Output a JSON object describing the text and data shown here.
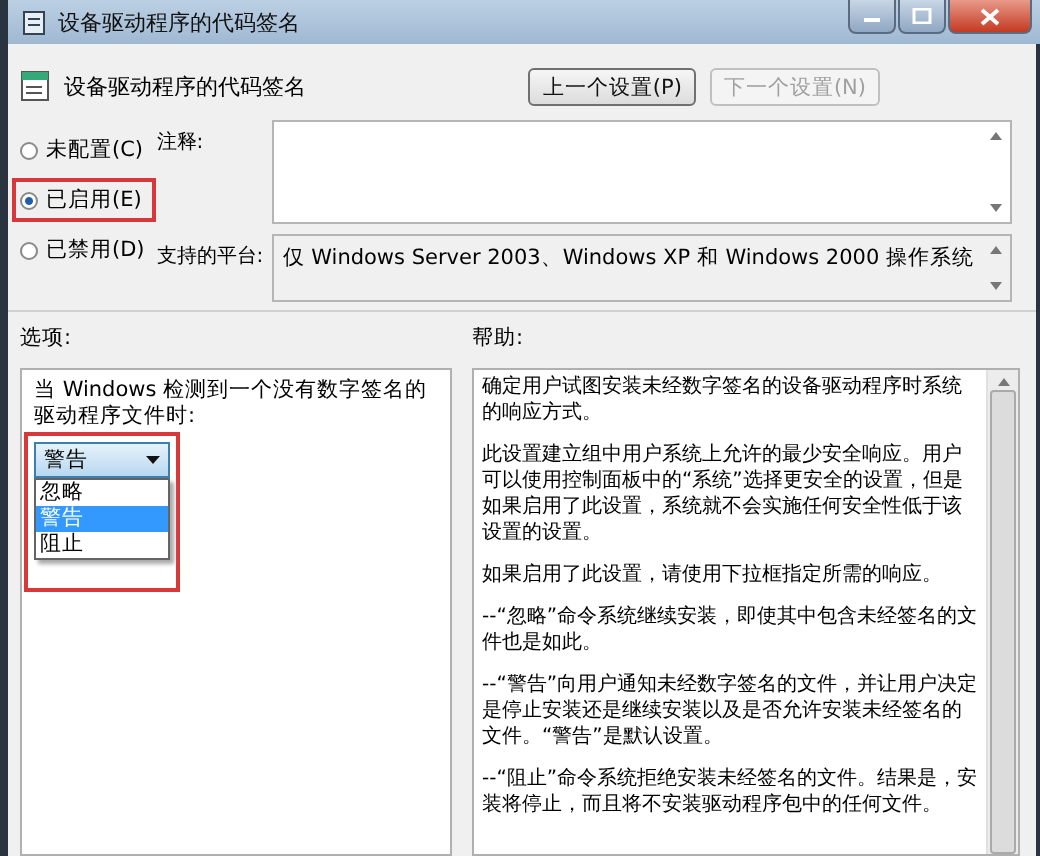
{
  "window": {
    "title": "设备驱动程序的代码签名"
  },
  "header": {
    "title": "设备驱动程序的代码签名"
  },
  "nav_buttons": [
    {
      "label": "上一个设置(P)",
      "disabled": false
    },
    {
      "label": "下一个设置(N)",
      "disabled": true
    }
  ],
  "state_options": [
    {
      "label": "未配置(C)",
      "selected": false,
      "highlighted": false
    },
    {
      "label": "已启用(E)",
      "selected": true,
      "highlighted": true
    },
    {
      "label": "已禁用(D)",
      "selected": false,
      "highlighted": false
    }
  ],
  "comment": {
    "label": "注释:"
  },
  "platform": {
    "label": "支持的平台:",
    "value": "仅 Windows Server 2003、Windows XP 和 Windows 2000 操作系统"
  },
  "options": {
    "label": "选项:",
    "prompt": "当 Windows 检测到一个没有数字签名的驱动程序文件时:",
    "dropdown": {
      "value": "警告",
      "expanded": true,
      "highlighted": true,
      "items": [
        {
          "label": "忽略",
          "selected": false
        },
        {
          "label": "警告",
          "selected": true
        },
        {
          "label": "阻止",
          "selected": false
        }
      ]
    }
  },
  "help": {
    "label": "帮助:",
    "paragraphs": [
      "确定用户试图安装未经数字签名的设备驱动程序时系统的响应方式。",
      "此设置建立组中用户系统上允许的最少安全响应。用户可以使用控制面板中的“系统”选择更安全的设置，但是如果启用了此设置，系统就不会实施任何安全性低于该设置的设置。",
      "如果启用了此设置，请使用下拉框指定所需的响应。",
      "--“忽略”命令系统继续安装，即使其中包含未经签名的文件也是如此。",
      "--“警告”向用户通知未经数字签名的文件，并让用户决定是停止安装还是继续安装以及是否允许安装未经签名的文件。“警告”是默认设置。",
      "--“阻止”命令系统拒绝安装未经签名的文件。结果是，安装将停止，而且将不安装驱动程序包中的任何文件。"
    ]
  }
}
